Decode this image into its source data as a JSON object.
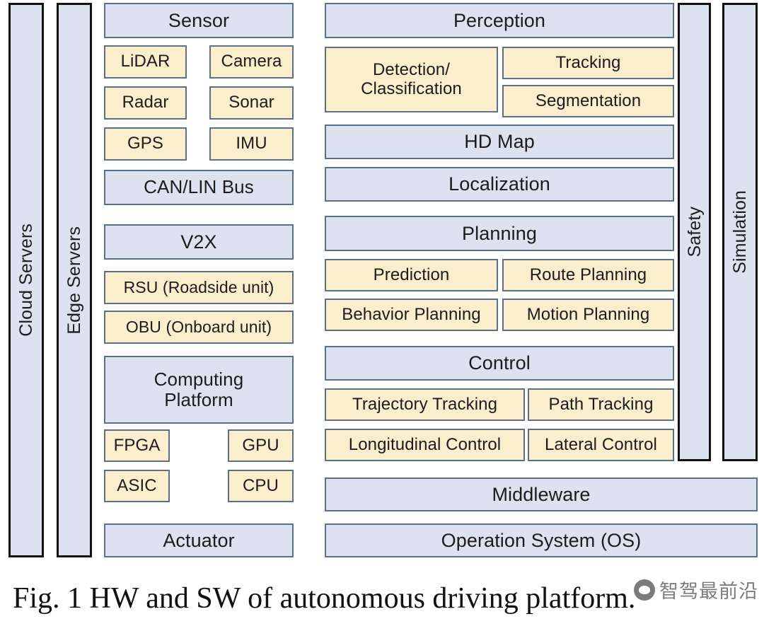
{
  "figure": {
    "caption": "Fig. 1 HW and SW of autonomous driving platform.",
    "watermark_text": "智驾最前沿",
    "watermark_logo": "panda-circle-logo"
  },
  "colors": {
    "blue_fill": "#dce2ef",
    "yellow_fill": "#fbeecc",
    "box_border": "#5c6f88",
    "pillar_border": "#111111",
    "text": "#1c1c1c",
    "background": "#ffffff"
  },
  "pillars": {
    "left": [
      {
        "label": "Cloud Servers"
      },
      {
        "label": "Edge Servers"
      }
    ],
    "right": [
      {
        "label": "Safety"
      },
      {
        "label": "Simulation"
      }
    ]
  },
  "hardware": {
    "groups": [
      {
        "header": "Sensor",
        "children": [
          "LiDAR",
          "Camera",
          "Radar",
          "Sonar",
          "GPS",
          "IMU"
        ]
      },
      {
        "header": "CAN/LIN Bus",
        "children": []
      },
      {
        "header": "V2X",
        "children": [
          "RSU (Roadside unit)",
          "OBU (Onboard unit)"
        ]
      },
      {
        "header": "Computing Platform",
        "header_line1": "Computing",
        "header_line2": "Platform",
        "children": [
          "FPGA",
          "GPU",
          "ASIC",
          "CPU"
        ]
      },
      {
        "header": "Actuator",
        "children": []
      }
    ]
  },
  "software": {
    "groups": [
      {
        "header": "Perception",
        "children": [
          "Detection/ Classification",
          "Tracking",
          "Segmentation"
        ],
        "detection_line1": "Detection/",
        "detection_line2": "Classification"
      },
      {
        "header": "HD Map",
        "children": []
      },
      {
        "header": "Localization",
        "children": []
      },
      {
        "header": "Planning",
        "children": [
          "Prediction",
          "Route Planning",
          "Behavior Planning",
          "Motion Planning"
        ]
      },
      {
        "header": "Control",
        "children": [
          "Trajectory Tracking",
          "Path Tracking",
          "Longitudinal Control",
          "Lateral Control"
        ]
      }
    ]
  },
  "platform_layers": [
    {
      "label": "Middleware"
    },
    {
      "label": "Operation System (OS)"
    }
  ]
}
